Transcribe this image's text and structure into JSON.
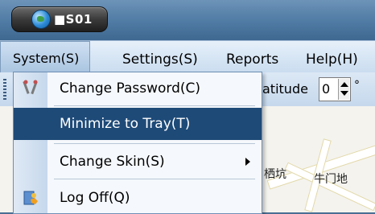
{
  "app": {
    "title": "■S01"
  },
  "menubar": {
    "items": [
      "System(S)",
      "Settings(S)",
      "Reports",
      "Help(H)"
    ]
  },
  "toolbar": {
    "latitude_label": "atitude",
    "latitude_value": "0",
    "degree": "°"
  },
  "dropdown": {
    "items": [
      {
        "label": "Change Password(C)",
        "icon": "tools-icon"
      },
      {
        "label": "Minimize to Tray(T)"
      },
      {
        "label": "Change Skin(S)",
        "submenu": true
      },
      {
        "label": "Log Off(Q)",
        "icon": "logoff-icon"
      }
    ]
  },
  "map": {
    "labels": [
      "栖坑",
      "牛门地"
    ]
  }
}
